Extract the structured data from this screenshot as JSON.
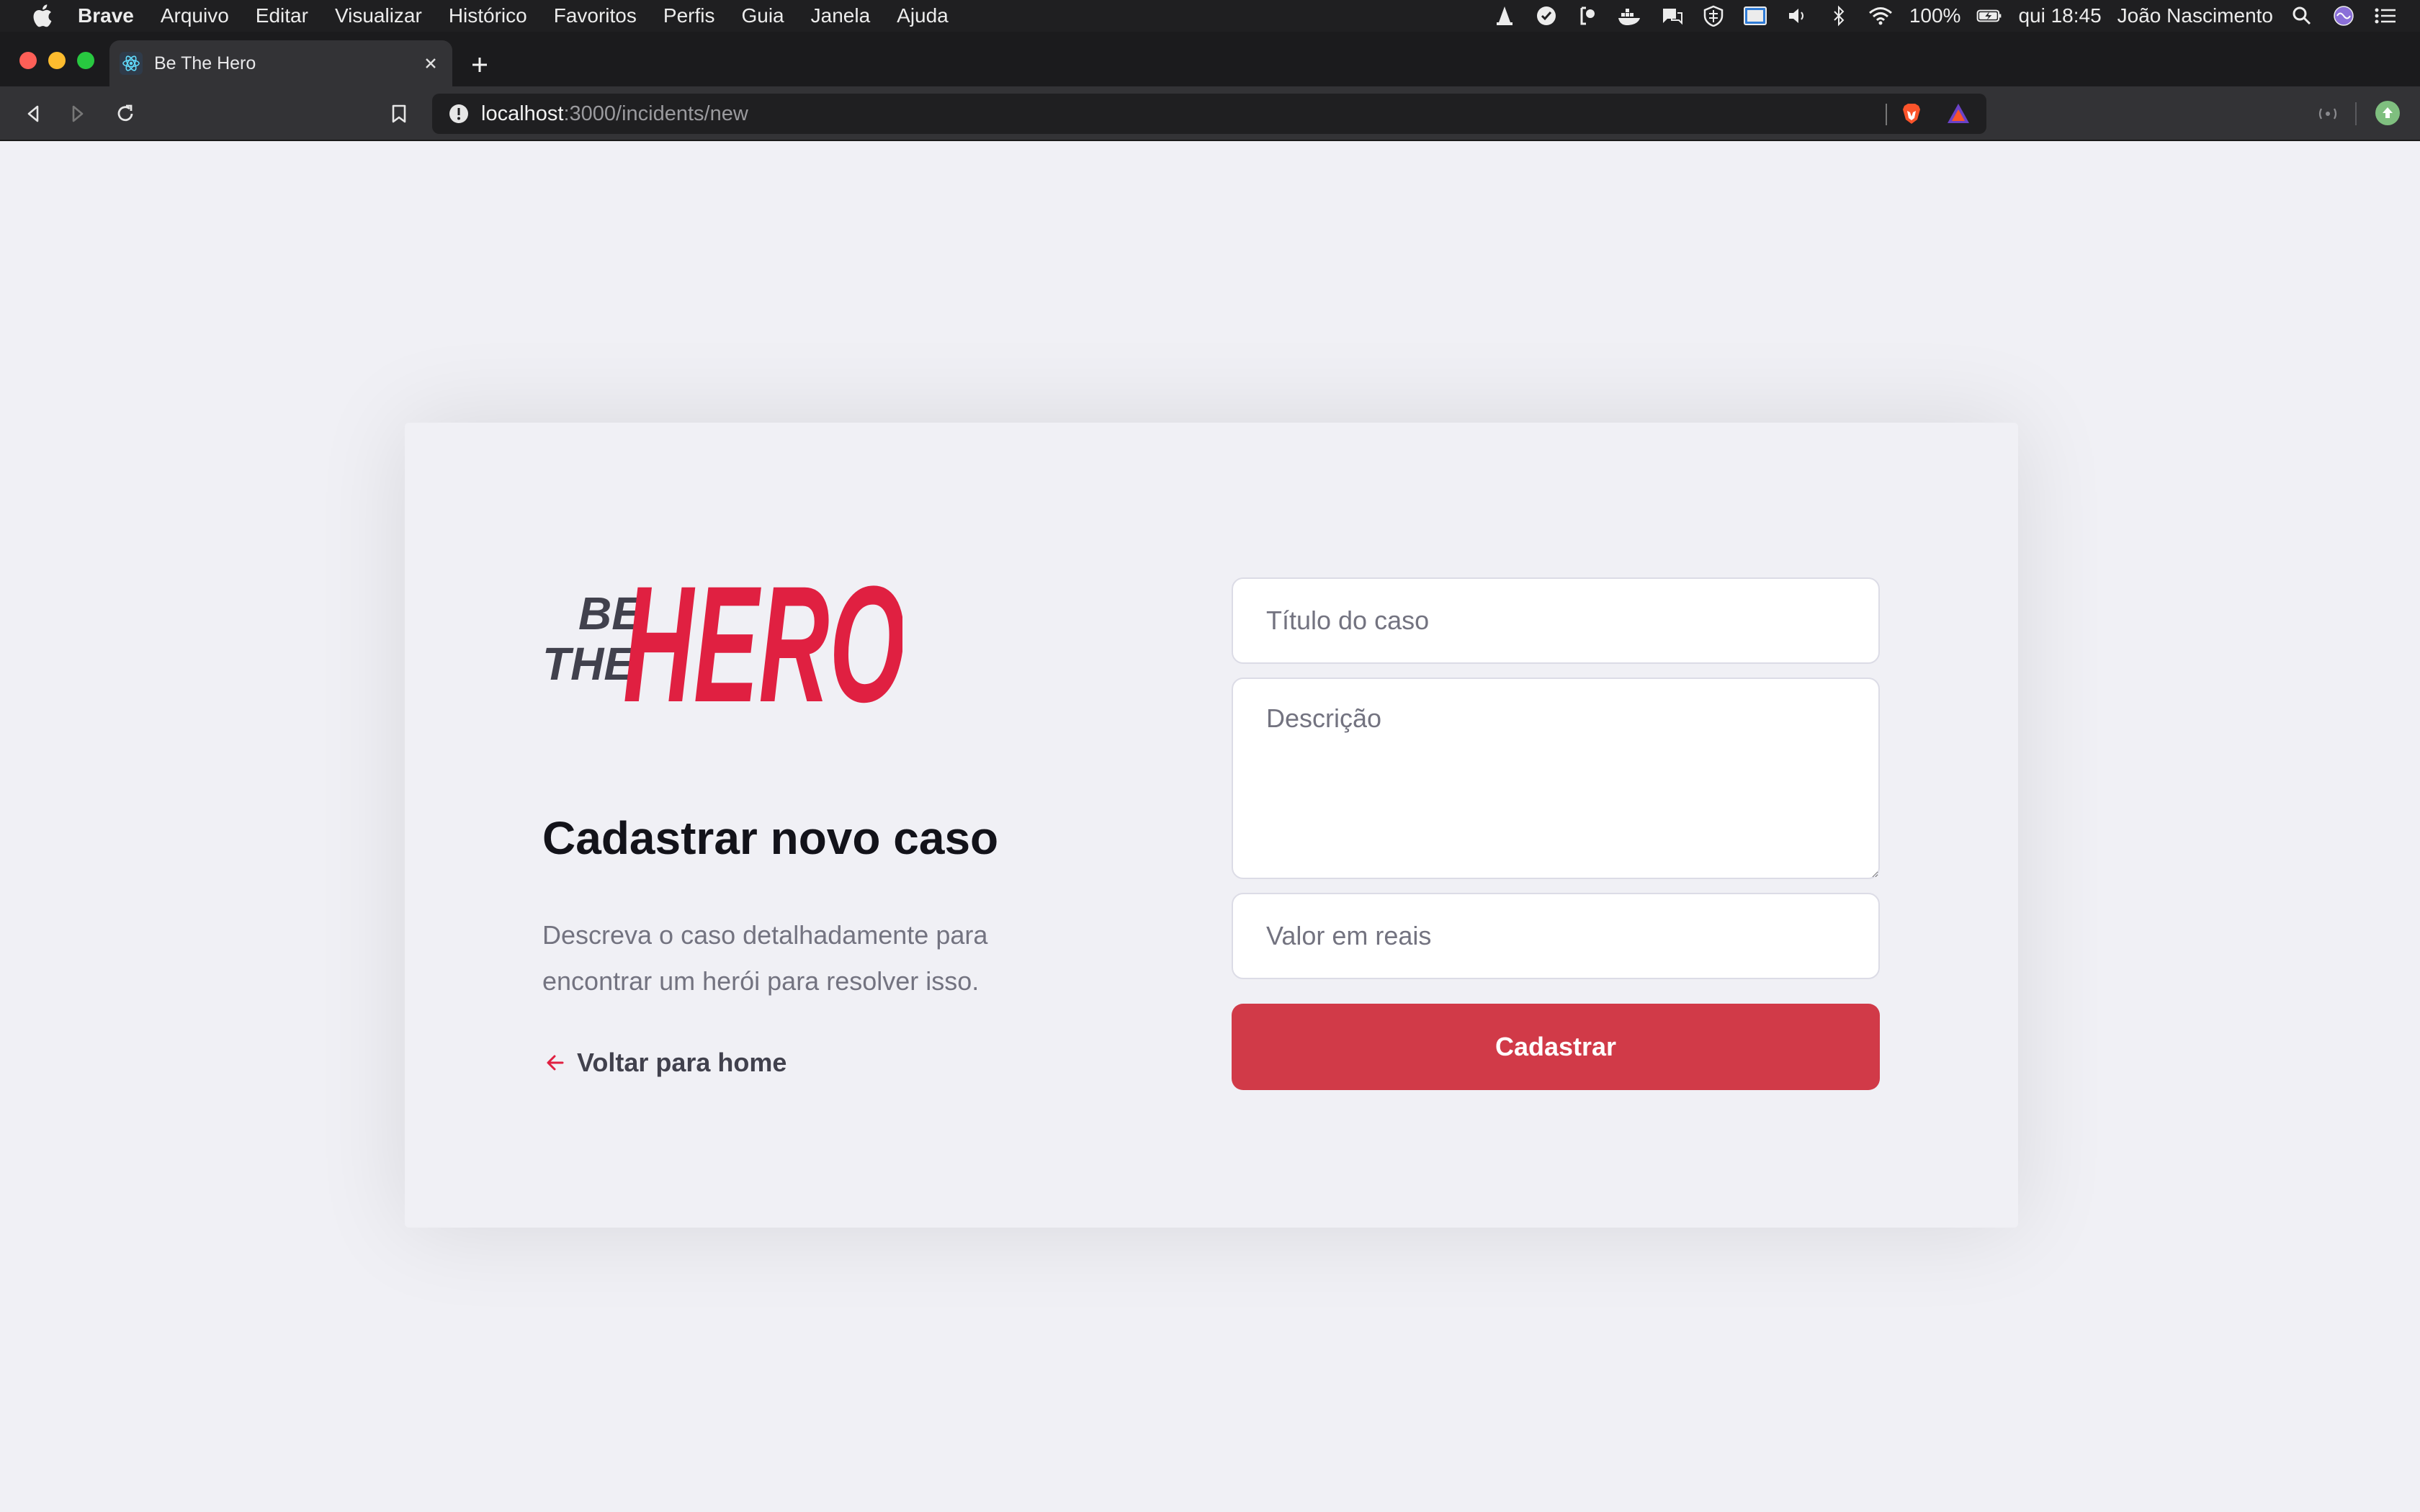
{
  "menubar": {
    "app_name": "Brave",
    "items": [
      "Arquivo",
      "Editar",
      "Visualizar",
      "Histórico",
      "Favoritos",
      "Perfis",
      "Guia",
      "Janela",
      "Ajuda"
    ],
    "battery": "100%",
    "clock": "qui 18:45",
    "user": "João Nascimento"
  },
  "browser": {
    "tab_title": "Be The Hero",
    "url_host": "localhost",
    "url_path": ":3000/incidents/new"
  },
  "page": {
    "logo_text": {
      "be": "BE",
      "the": "THE",
      "hero": "HERO"
    },
    "title": "Cadastrar novo caso",
    "description": "Descreva o caso detalhadamente para encontrar um herói para resolver isso.",
    "back_link": "Voltar para home",
    "form": {
      "title_placeholder": "Título do caso",
      "description_placeholder": "Descrição",
      "value_placeholder": "Valor em reais",
      "submit_label": "Cadastrar"
    },
    "colors": {
      "brand_red": "#e02041",
      "button_red": "#d13a48",
      "background": "#f0f0f5",
      "heading": "#13131a",
      "muted": "#737380"
    }
  }
}
